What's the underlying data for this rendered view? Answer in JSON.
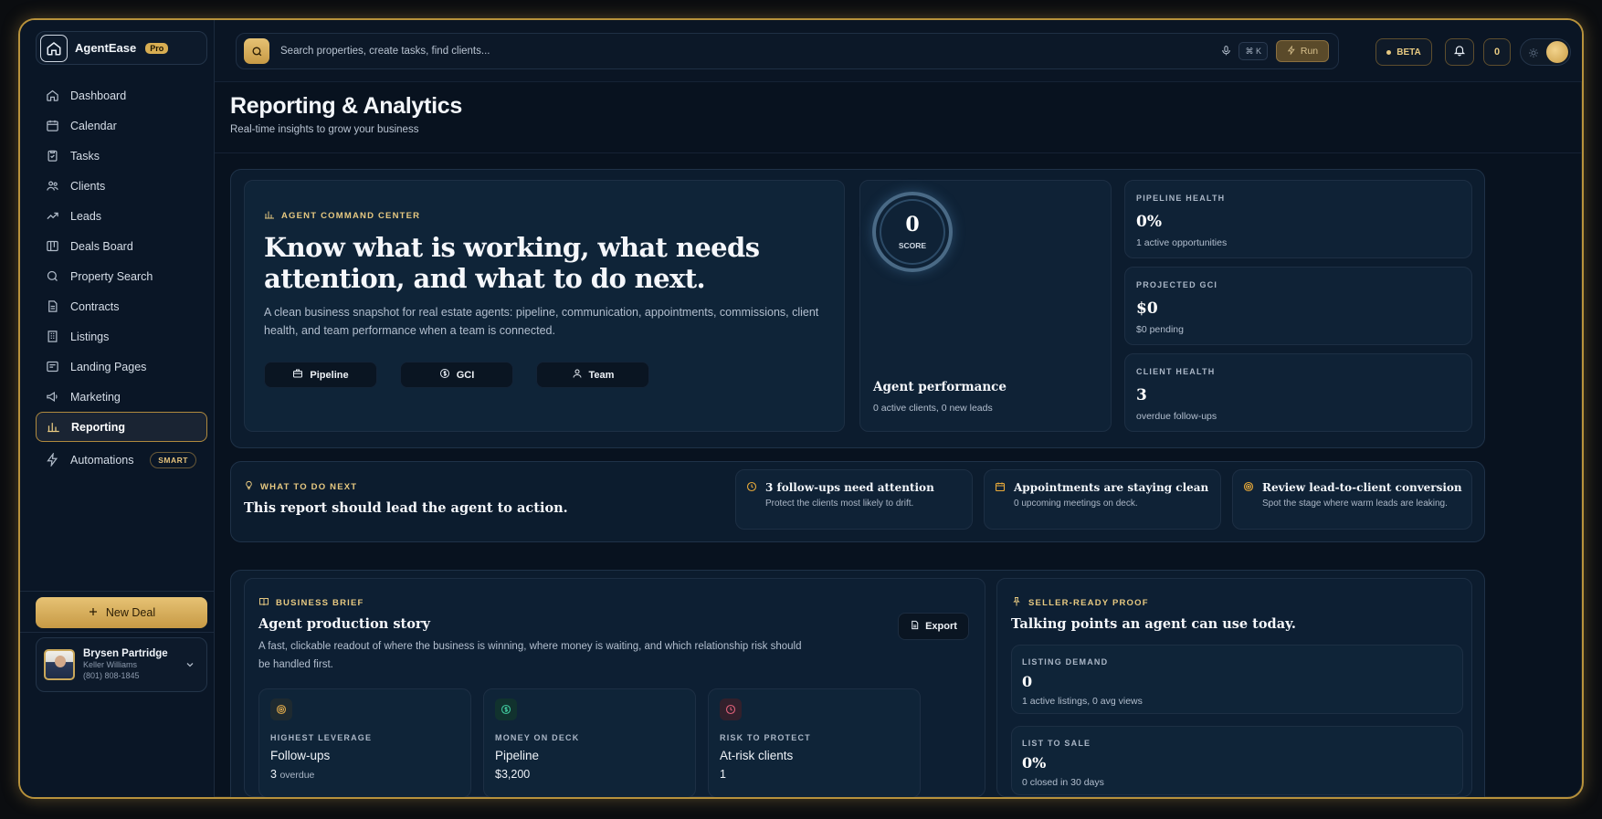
{
  "brand": {
    "name": "AgentEase",
    "badge": "Pro"
  },
  "sidebar": {
    "items": [
      {
        "label": "Dashboard",
        "icon": "home-icon"
      },
      {
        "label": "Calendar",
        "icon": "calendar-icon"
      },
      {
        "label": "Tasks",
        "icon": "clipboard-check-icon"
      },
      {
        "label": "Clients",
        "icon": "users-icon"
      },
      {
        "label": "Leads",
        "icon": "trending-up-icon"
      },
      {
        "label": "Deals Board",
        "icon": "kanban-icon"
      },
      {
        "label": "Property Search",
        "icon": "search-icon"
      },
      {
        "label": "Contracts",
        "icon": "document-icon"
      },
      {
        "label": "Listings",
        "icon": "building-icon"
      },
      {
        "label": "Landing Pages",
        "icon": "layout-icon"
      },
      {
        "label": "Marketing",
        "icon": "megaphone-icon"
      },
      {
        "label": "Reporting",
        "icon": "bar-chart-icon",
        "active": true
      },
      {
        "label": "Automations",
        "icon": "lightning-icon",
        "badge": "SMART"
      }
    ],
    "new_deal": "New Deal",
    "user": {
      "name": "Brysen Partridge",
      "company": "Keller Williams",
      "phone": "(801) 808-1845"
    }
  },
  "topbar": {
    "search_placeholder": "Search properties, create tasks, find clients...",
    "shortcut": "⌘ K",
    "run": "Run",
    "beta": "BETA",
    "count": "0"
  },
  "page": {
    "title": "Reporting & Analytics",
    "subtitle": "Real-time insights to grow your business"
  },
  "command_center": {
    "eyebrow": "AGENT COMMAND CENTER",
    "title": "Know what is working, what needs attention, and what to do next.",
    "description": "A clean business snapshot for real estate agents: pipeline, communication, appointments, commissions, client health, and team performance when a team is connected.",
    "pills": [
      "Pipeline",
      "GCI",
      "Team"
    ]
  },
  "score": {
    "value": "0",
    "label": "SCORE",
    "title": "Agent performance",
    "sub": "0 active clients, 0 new leads"
  },
  "metrics": [
    {
      "label": "PIPELINE HEALTH",
      "value": "0%",
      "sub": "1 active opportunities"
    },
    {
      "label": "PROJECTED GCI",
      "value": "$0",
      "sub": "$0 pending"
    },
    {
      "label": "CLIENT HEALTH",
      "value": "3",
      "sub": "overdue follow-ups"
    }
  ],
  "next": {
    "eyebrow": "WHAT TO DO NEXT",
    "title": "This report should lead the agent to action.",
    "cards": [
      {
        "title": "3 follow-ups need attention",
        "sub": "Protect the clients most likely to drift."
      },
      {
        "title": "Appointments are staying clean",
        "sub": "0 upcoming meetings on deck."
      },
      {
        "title": "Review lead-to-client conversion",
        "sub": "Spot the stage where warm leads are leaking."
      }
    ]
  },
  "brief": {
    "eyebrow": "BUSINESS BRIEF",
    "title": "Agent production story",
    "export": "Export",
    "description": "A fast, clickable readout of where the business is winning, where money is waiting, and which relationship risk should be handled first.",
    "cards": [
      {
        "label": "HIGHEST LEVERAGE",
        "value": "Follow-ups",
        "meta": "3",
        "meta_suffix": "overdue",
        "color": "#d9a64a"
      },
      {
        "label": "MONEY ON DECK",
        "value": "Pipeline",
        "meta": "$3,200",
        "meta_suffix": "",
        "color": "#3fc49a"
      },
      {
        "label": "RISK TO PROTECT",
        "value": "At-risk clients",
        "meta": "1",
        "meta_suffix": "",
        "color": "#e0607a"
      }
    ]
  },
  "proof": {
    "eyebrow": "SELLER-READY PROOF",
    "title": "Talking points an agent can use today.",
    "cards": [
      {
        "label": "LISTING DEMAND",
        "value": "0",
        "sub": "1 active listings, 0 avg views"
      },
      {
        "label": "LIST TO SALE",
        "value": "0%",
        "sub": "0 closed in 30 days"
      }
    ]
  },
  "colors": {
    "accent": "#d7ad52",
    "background": "#08121f",
    "panel": "#0c1c2e"
  }
}
